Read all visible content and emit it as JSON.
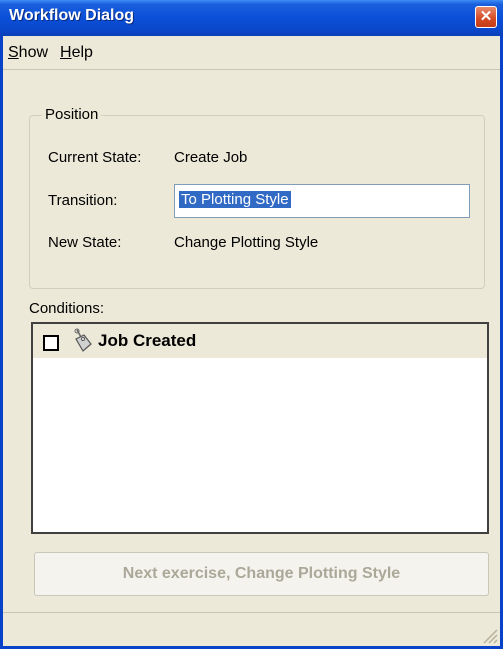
{
  "window": {
    "title": "Workflow Dialog",
    "close_glyph": "✕"
  },
  "menu": {
    "show": {
      "accel": "S",
      "rest": "how"
    },
    "help": {
      "accel": "H",
      "rest": "elp"
    }
  },
  "position": {
    "legend": "Position",
    "current_state_label": "Current State:",
    "current_state_value": "Create Job",
    "transition_label": "Transition:",
    "transition_value": "To Plotting Style",
    "new_state_label": "New State:",
    "new_state_value": "Change Plotting Style"
  },
  "conditions": {
    "label": "Conditions:",
    "items": [
      {
        "label": "Job Created",
        "checked": false,
        "icon": "tag-icon"
      }
    ]
  },
  "next_button": {
    "label": "Next exercise, Change Plotting Style",
    "enabled": false
  },
  "colors": {
    "titlebar": "#0a46c9",
    "selection": "#316ac5",
    "face": "#ece9d8"
  }
}
